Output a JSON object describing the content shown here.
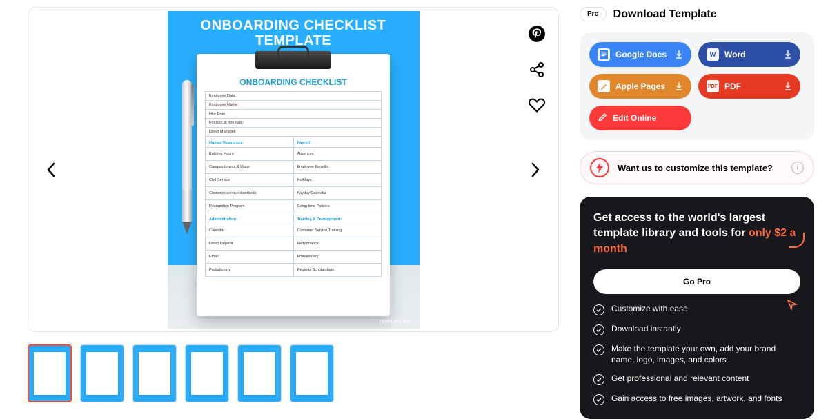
{
  "download": {
    "pro_badge": "Pro",
    "title": "Download Template",
    "buttons": {
      "gdocs": "Google Docs",
      "word": "Word",
      "pages": "Apple Pages",
      "pdf": "PDF",
      "edit": "Edit Online"
    }
  },
  "customize": {
    "text": "Want us to customize this template?"
  },
  "promo": {
    "headline_a": "Get access to the world's largest template library and tools for ",
    "headline_accent": "only $2 a month",
    "gopro": "Go Pro",
    "features": [
      "Customize with ease",
      "Download instantly",
      "Make the template your own, add your brand name, logo, images, and colors",
      "Get professional and relevant content",
      "Gain access to free images, artwork, and fonts"
    ]
  },
  "preview": {
    "template_title_l1": "ONBOARDING CHECKLIST",
    "template_title_l2": "TEMPLATE",
    "doc_title": "ONBOARDING CHECKLIST",
    "head_rows": [
      "Employee Data",
      "Employee Name:",
      "Hire Date:",
      "Position at hire date:",
      "Direct Manager:"
    ],
    "col_left": {
      "sections": [
        {
          "title": "Human Resources:",
          "rows": [
            "Building Hours",
            "Campus Layout & Maps",
            "Civil Service",
            "Customer service standards",
            "Recognition Program"
          ]
        },
        {
          "title": "Administration:",
          "rows": [
            "Calendar",
            "Direct Deposit",
            "Email",
            "Probationary"
          ]
        }
      ]
    },
    "col_right": {
      "sections": [
        {
          "title": "Payroll:",
          "rows": [
            "Absences",
            "Employee Benefits",
            "Holidays",
            "Payday Calendar",
            "Comp time Policies"
          ]
        },
        {
          "title": "Training & Development:",
          "rows": [
            "Customer Service Training",
            "Performance",
            "Probationary",
            "Regents Scholarships"
          ]
        }
      ]
    },
    "watermark": "TEMPLATE.NET"
  },
  "thumbs": [
    "1",
    "2",
    "3",
    "4",
    "5",
    "6"
  ]
}
